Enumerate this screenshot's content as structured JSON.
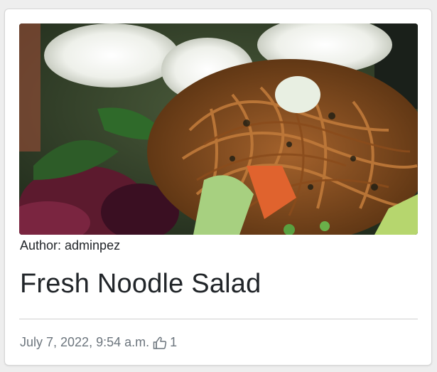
{
  "post": {
    "author_label": "Author: adminpez",
    "title": "Fresh Noodle Salad",
    "date": "July 7, 2022, 9:54 a.m.",
    "like_count": "1",
    "image_subject": "noodle-salad-photo",
    "like_icon": "thumbs-up-icon"
  },
  "colors": {
    "background": "#eeeeee",
    "card": "#ffffff",
    "text": "#212529",
    "muted": "#6c757d",
    "divider": "#cfcfcf"
  }
}
